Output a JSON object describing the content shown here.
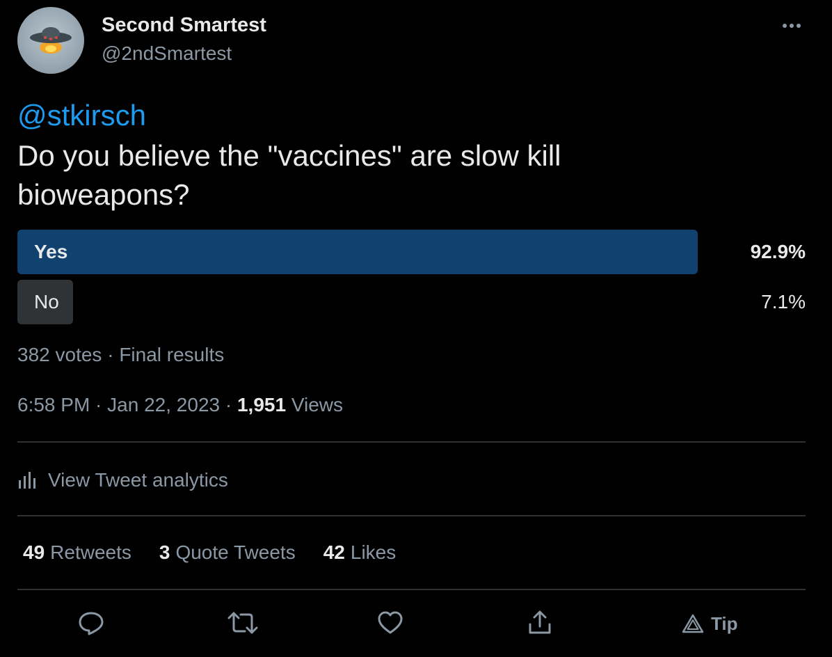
{
  "author": {
    "display_name": "Second Smartest",
    "handle": "@2ndSmartest"
  },
  "tweet": {
    "mention": "@stkirsch",
    "text": "Do you believe the \"vaccines\" are slow kill bioweapons?"
  },
  "poll": {
    "options": [
      {
        "label": "Yes",
        "percent": "92.9%",
        "value": 92.9,
        "winner": true
      },
      {
        "label": "No",
        "percent": "7.1%",
        "value": 7.1,
        "winner": false
      }
    ],
    "votes": "382 votes",
    "separator": " · ",
    "status": "Final results"
  },
  "meta": {
    "time": "6:58 PM",
    "sep1": " · ",
    "date": "Jan 22, 2023",
    "sep2": " · ",
    "views_count": "1,951",
    "views_label": " Views"
  },
  "analytics": {
    "label": "View Tweet analytics",
    "icon": "bar-chart-icon"
  },
  "stats": {
    "retweets_count": "49",
    "retweets_label": "Retweets",
    "quotes_count": "3",
    "quotes_label": "Quote Tweets",
    "likes_count": "42",
    "likes_label": "Likes"
  },
  "actions": {
    "icons": [
      "reply-icon",
      "retweet-icon",
      "like-icon",
      "share-icon",
      "tip-icon"
    ],
    "tip_label": "Tip"
  },
  "colors": {
    "background": "#000000",
    "primary_text": "#e7e9ea",
    "secondary_text": "#8b98a5",
    "link": "#1d9bf0",
    "poll_winner": "#11426f",
    "poll_other": "#2f3336",
    "divider": "#2f3336"
  }
}
